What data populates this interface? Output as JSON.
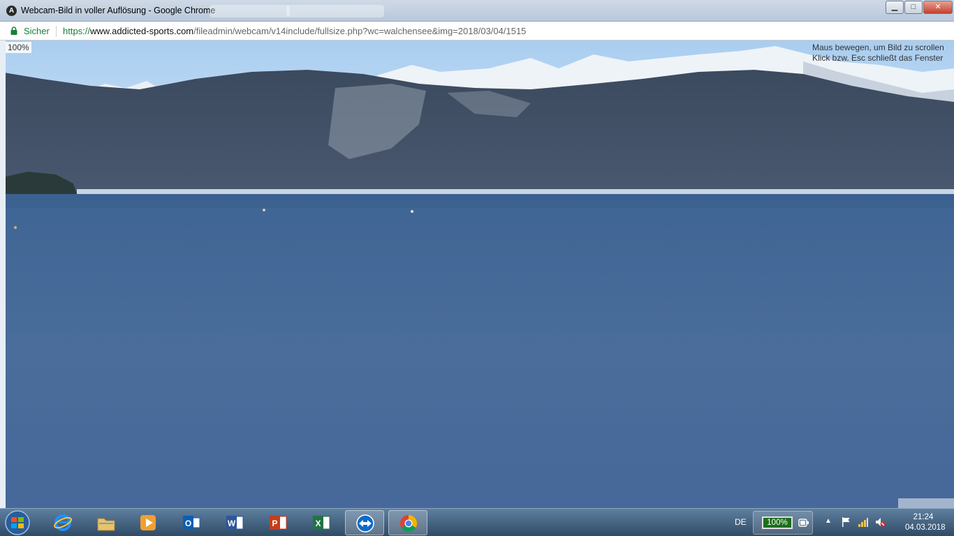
{
  "window": {
    "title": "Webcam-Bild in voller Auflösung - Google Chrome",
    "app_icon_letter": "A",
    "controls": {
      "minimize": "▁",
      "maximize": "□",
      "close": "✕"
    }
  },
  "address_bar": {
    "secure_label": "Sicher",
    "url_scheme": "https://",
    "url_host": "www.addicted-sports.com",
    "url_path": "/fileadmin/webcam/v14include/fullsize.php?wc=walchensee&img=2018/03/04/1515"
  },
  "content": {
    "zoom": "100%",
    "hint_line1": "Maus bewegen, um Bild zu scrollen",
    "hint_line2": "Klick bzw. Esc schließt das Fenster",
    "image_subject": "Walchensee webcam view: lake with snow-capped mountains"
  },
  "taskbar": {
    "apps": [
      {
        "name": "internet-explorer",
        "icon": "ie-icon"
      },
      {
        "name": "file-explorer",
        "icon": "folder-icon"
      },
      {
        "name": "media-player",
        "icon": "media-player-icon"
      },
      {
        "name": "outlook",
        "icon": "outlook-icon",
        "letter": "O"
      },
      {
        "name": "word",
        "icon": "word-icon",
        "letter": "W"
      },
      {
        "name": "powerpoint",
        "icon": "powerpoint-icon",
        "letter": "P"
      },
      {
        "name": "excel",
        "icon": "excel-icon",
        "letter": "X"
      },
      {
        "name": "teamviewer",
        "icon": "teamviewer-icon"
      },
      {
        "name": "chrome",
        "icon": "chrome-icon"
      }
    ],
    "language": "DE",
    "battery": "100%",
    "time": "21:24",
    "date": "04.03.2018",
    "colors": {
      "battery_fill": "#1c6e1c"
    }
  }
}
